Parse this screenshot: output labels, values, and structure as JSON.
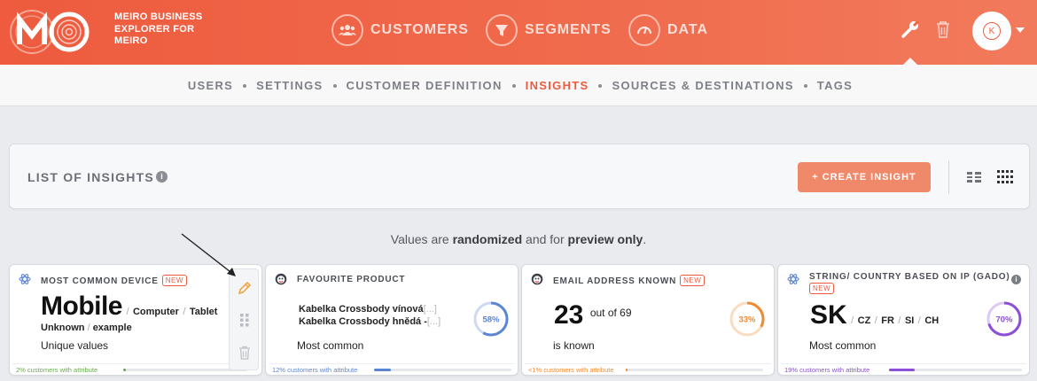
{
  "brand": {
    "logo_text": "MO",
    "line1": "MEIRO BUSINESS",
    "line2": "EXPLORER FOR",
    "line3": "MEIRO"
  },
  "nav": {
    "customers": "CUSTOMERS",
    "segments": "SEGMENTS",
    "data": "DATA"
  },
  "user": {
    "initial": "K"
  },
  "subnav": {
    "items": [
      "USERS",
      "SETTINGS",
      "CUSTOMER DEFINITION",
      "INSIGHTS",
      "SOURCES & DESTINATIONS",
      "TAGS"
    ],
    "active": "INSIGHTS"
  },
  "panel": {
    "title": "LIST OF INSIGHTS",
    "info": "i",
    "create_label": "+ CREATE INSIGHT"
  },
  "notice": {
    "pre": "Values are ",
    "b1": "randomized",
    "mid": " and for ",
    "b2": "preview only",
    "post": "."
  },
  "cards": [
    {
      "title": "MOST COMMON DEVICE",
      "badge": "NEW",
      "main_value": "Mobile",
      "others": [
        "Computer",
        "Tablet",
        "Unknown",
        "example"
      ],
      "subtitle": "Unique values",
      "bar_label": "2% customers with attribute",
      "bar_fraction": 0.02,
      "color": "#6aa84f"
    },
    {
      "title": "FAVOURITE PRODUCT",
      "line1": "Kabelka Crossbody vínová",
      "line2": "Kabelka Crossbody hnědá -",
      "ellipsis": "[...]",
      "percent_label": "58%",
      "percent": 58,
      "subtitle": "Most common",
      "bar_label": "12% customers with attribute",
      "bar_fraction": 0.12,
      "color": "#5b86d4"
    },
    {
      "title": "EMAIL ADDRESS KNOWN",
      "badge": "NEW",
      "main_value": "23",
      "out_of": "out of 69",
      "percent_label": "33%",
      "percent": 33,
      "subtitle": "is known",
      "bar_label": "<1% customers with attribute",
      "bar_fraction": 0.005,
      "color": "#ee8a2f"
    },
    {
      "title": "STRING/ COUNTRY BASED ON IP (GADO)",
      "badge": "NEW",
      "main_value": "SK",
      "others": [
        "CZ",
        "FR",
        "SI",
        "CH"
      ],
      "percent_label": "70%",
      "percent": 70,
      "subtitle": "Most common",
      "bar_label": "19% customers with attribute",
      "bar_fraction": 0.19,
      "color": "#8b4fd8"
    }
  ],
  "icons": {
    "nav": [
      "customers-icon",
      "segments-icon",
      "data-icon"
    ],
    "header": [
      "wrench-icon",
      "trash-icon",
      "chevron-down-icon"
    ],
    "card_tools": [
      "pencil-icon",
      "drag-handle-icon",
      "trash-icon"
    ],
    "view": [
      "list-view-icon",
      "grid-view-icon"
    ]
  }
}
